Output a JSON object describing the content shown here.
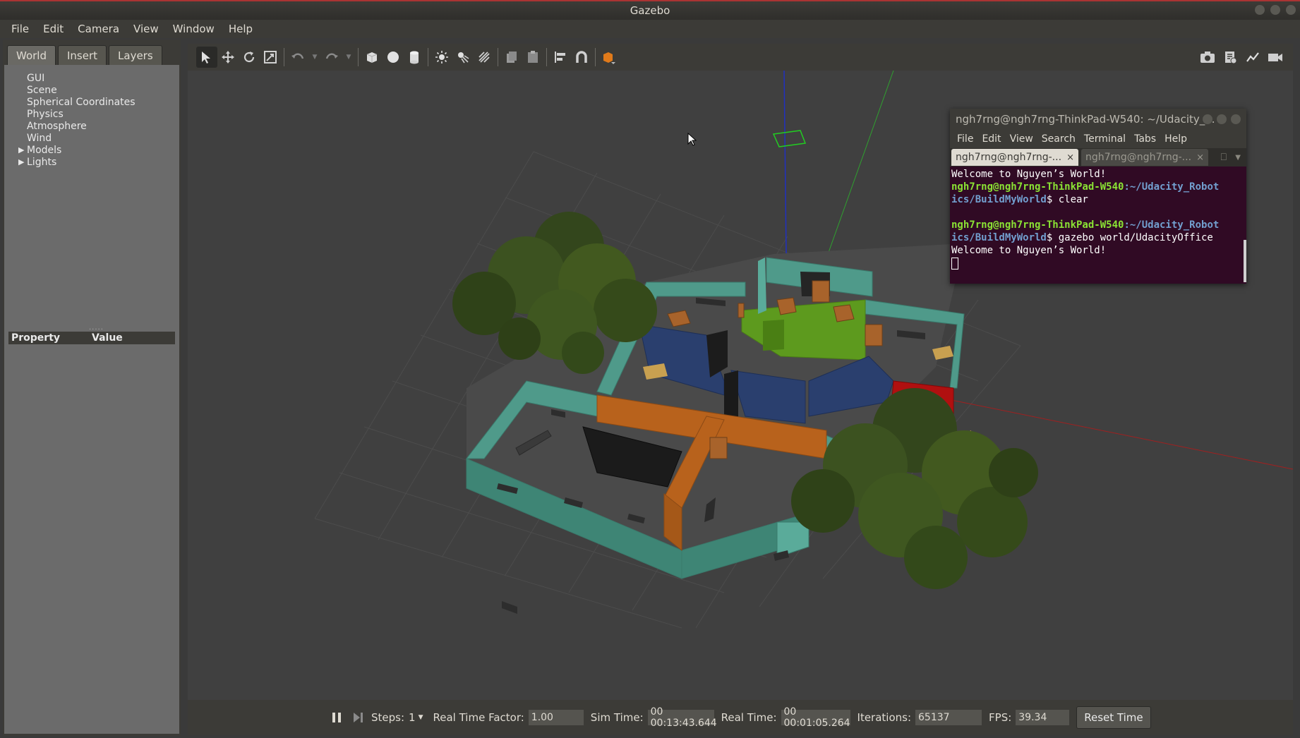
{
  "window": {
    "title": "Gazebo"
  },
  "menubar": {
    "items": [
      "File",
      "Edit",
      "Camera",
      "View",
      "Window",
      "Help"
    ]
  },
  "left_panel": {
    "tabs": [
      "World",
      "Insert",
      "Layers"
    ],
    "active_tab": "World",
    "tree": [
      {
        "label": "GUI",
        "expandable": false
      },
      {
        "label": "Scene",
        "expandable": false
      },
      {
        "label": "Spherical Coordinates",
        "expandable": false
      },
      {
        "label": "Physics",
        "expandable": false
      },
      {
        "label": "Atmosphere",
        "expandable": false
      },
      {
        "label": "Wind",
        "expandable": false
      },
      {
        "label": "Models",
        "expandable": true
      },
      {
        "label": "Lights",
        "expandable": true
      }
    ],
    "properties": {
      "col_property": "Property",
      "col_value": "Value"
    }
  },
  "toolbar": {
    "tools": [
      "select-arrow-icon",
      "translate-icon",
      "rotate-icon",
      "scale-icon",
      "undo-icon",
      "redo-icon",
      "box-icon",
      "sphere-icon",
      "cylinder-icon",
      "point-light-icon",
      "spot-light-icon",
      "directional-light-icon",
      "copy-icon",
      "paste-icon",
      "align-icon",
      "snap-icon",
      "view-angle-icon"
    ],
    "right_tools": [
      "screenshot-icon",
      "record-icon",
      "plot-icon",
      "video-icon"
    ]
  },
  "terminal": {
    "title": "ngh7rng@ngh7rng-ThinkPad-W540: ~/Udacity_...",
    "menu": [
      "File",
      "Edit",
      "View",
      "Search",
      "Terminal",
      "Tabs",
      "Help"
    ],
    "tabs": [
      "ngh7rng@ngh7rng-...",
      "ngh7rng@ngh7rng-..."
    ],
    "lines": {
      "l1": "Welcome to Nguyen’s World!",
      "prompt1_user": "ngh7rng@ngh7rng-ThinkPad-W540",
      "prompt1_path_a": ":~/Udacity_Robot",
      "prompt1_path_b": "ics/BuildMyWorld",
      "cmd1": "$ clear",
      "prompt2_user": "ngh7rng@ngh7rng-ThinkPad-W540",
      "prompt2_path_a": ":~/Udacity_Robot",
      "prompt2_path_b": "ics/BuildMyWorld",
      "cmd2": "$ gazebo world/UdacityOffice",
      "l_last": "Welcome to Nguyen’s World!"
    }
  },
  "statusbar": {
    "steps_label": "Steps:",
    "steps_value": "1",
    "rtf_label": "Real Time Factor:",
    "rtf_value": "1.00",
    "sim_time_label": "Sim Time:",
    "sim_time_value": "00 00:13:43.644",
    "real_time_label": "Real Time:",
    "real_time_value": "00 00:01:05.264",
    "iterations_label": "Iterations:",
    "iterations_value": "65137",
    "fps_label": "FPS:",
    "fps_value": "39.34",
    "reset_label": "Reset Time"
  },
  "colors": {
    "wall_teal": "#4f9a8a",
    "wall_orange": "#b8621c",
    "wall_blue": "#2a3f6e",
    "wall_green": "#5d9a1e",
    "wall_red": "#b01010",
    "floor": "#4a4a4a",
    "terminal_bg": "#300a24"
  }
}
